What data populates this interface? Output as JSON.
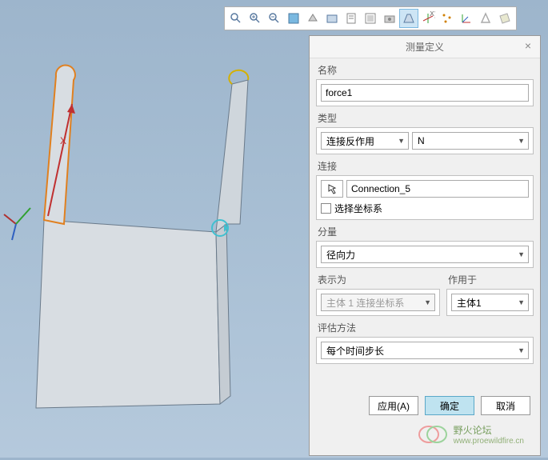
{
  "dialog": {
    "title": "测量定义",
    "name_label": "名称",
    "name_value": "force1",
    "type_label": "类型",
    "type_value": "连接反作用",
    "type_unit": "N",
    "connection_label": "连接",
    "connection_value": "Connection_5",
    "coord_checkbox_label": "选择坐标系",
    "component_label": "分量",
    "component_value": "径向力",
    "express_label": "表示为",
    "express_value": "主体 1 连接坐标系",
    "apply_to_label": "作用于",
    "apply_to_value": "主体1",
    "eval_label": "评估方法",
    "eval_value": "每个时间步长"
  },
  "buttons": {
    "apply": "应用(A)",
    "ok": "确定",
    "cancel": "取消"
  },
  "watermark": {
    "name": "野火论坛",
    "url": "www.proewildfire.cn"
  }
}
